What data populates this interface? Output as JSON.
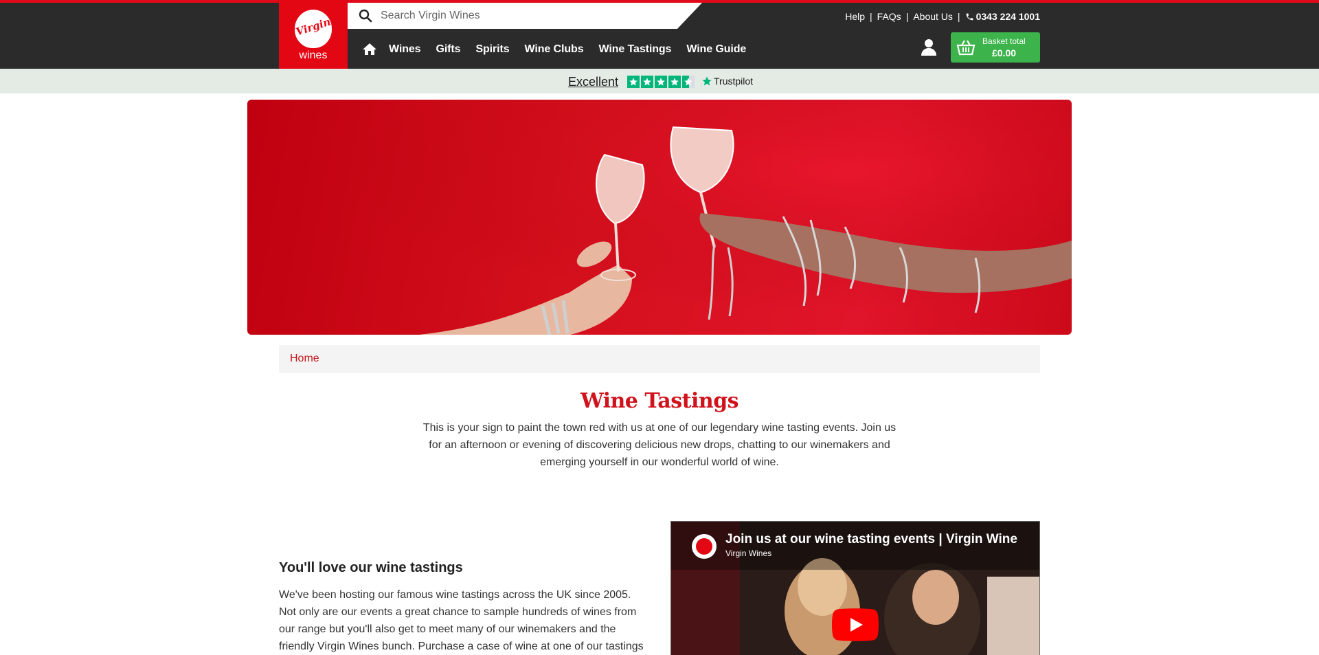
{
  "header": {
    "logo_text": "wines",
    "logo_script": "Virgin",
    "search_placeholder": "Search Virgin Wines",
    "top_links": [
      "Help",
      "FAQs",
      "About Us"
    ],
    "phone": "0343 224 1001",
    "nav": [
      "Wines",
      "Gifts",
      "Spirits",
      "Wine Clubs",
      "Wine Tastings",
      "Wine Guide"
    ],
    "basket_label": "Basket total",
    "basket_amount": "£0.00"
  },
  "trustpilot": {
    "rating_text": "Excellent",
    "brand": "Trustpilot"
  },
  "breadcrumb": {
    "home": "Home"
  },
  "page": {
    "title": "Wine Tastings",
    "intro": "This is your sign to paint the town red with us at one of our legendary wine tasting events. Join us for an afternoon or evening of discovering delicious new drops, chatting to our winemakers and emerging yourself in our wonderful world of wine.",
    "section_heading": "You'll love our wine tastings",
    "section_text": "We've been hosting our famous wine tastings across the UK since 2005. Not only are our events a great chance to sample hundreds of wines from our range but you'll also get to meet many of our winemakers and the friendly Virgin Wines bunch. Purchase a case of wine at one of our tastings"
  },
  "video": {
    "title": "Join us at our wine tasting events | Virgin Wine",
    "channel": "Virgin Wines"
  },
  "colors": {
    "brand_red": "#e30613",
    "header_bg": "#2b2b2b",
    "basket_green": "#3cb44b",
    "trustpilot_green": "#00b67a",
    "title_red": "#d0121b"
  }
}
